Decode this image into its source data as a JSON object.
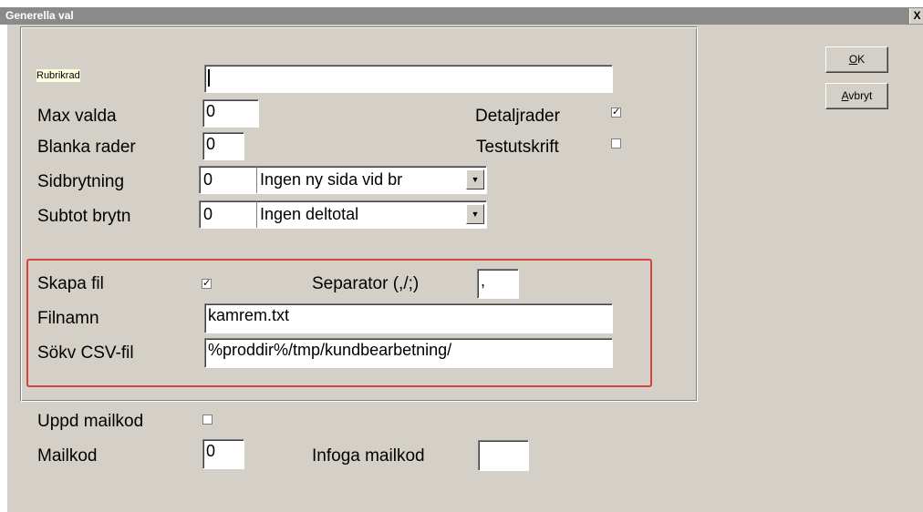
{
  "window": {
    "title": "Generella val",
    "close_label": "X"
  },
  "buttons": {
    "ok_accel": "O",
    "ok_rest": "K",
    "cancel_accel": "A",
    "cancel_rest": "vbryt"
  },
  "form": {
    "rubrikrad": {
      "label": "Rubrikrad",
      "value": ""
    },
    "max_valda": {
      "label": "Max valda",
      "value": "0"
    },
    "blanka_rader": {
      "label": "Blanka rader",
      "value": "0"
    },
    "sidbrytning": {
      "label": "Sidbrytning",
      "value": "0",
      "selected": "Ingen ny sida vid br"
    },
    "subtot_brytn": {
      "label": "Subtot brytn",
      "value": "0",
      "selected": "Ingen deltotal"
    },
    "detaljrader": {
      "label": "Detaljrader",
      "checked": true
    },
    "testutskrift": {
      "label": "Testutskrift",
      "checked": false
    },
    "skapa_fil": {
      "label": "Skapa fil",
      "checked": true
    },
    "separator": {
      "label": "Separator (,/;)",
      "value": ","
    },
    "filnamn": {
      "label": "Filnamn",
      "value": "kamrem.txt"
    },
    "sokv_csv": {
      "label": "Sökv CSV-fil",
      "value": "%proddir%/tmp/kundbearbetning/"
    },
    "uppd_mailkod": {
      "label": "Uppd mailkod",
      "checked": false
    },
    "mailkod": {
      "label": "Mailkod",
      "value": "0"
    },
    "infoga_mailkod": {
      "label": "Infoga mailkod",
      "value": ""
    }
  },
  "colors": {
    "title_bar": "#8a8a8a",
    "dialog_bg": "#d4d0c8",
    "highlight": "#d94040"
  }
}
